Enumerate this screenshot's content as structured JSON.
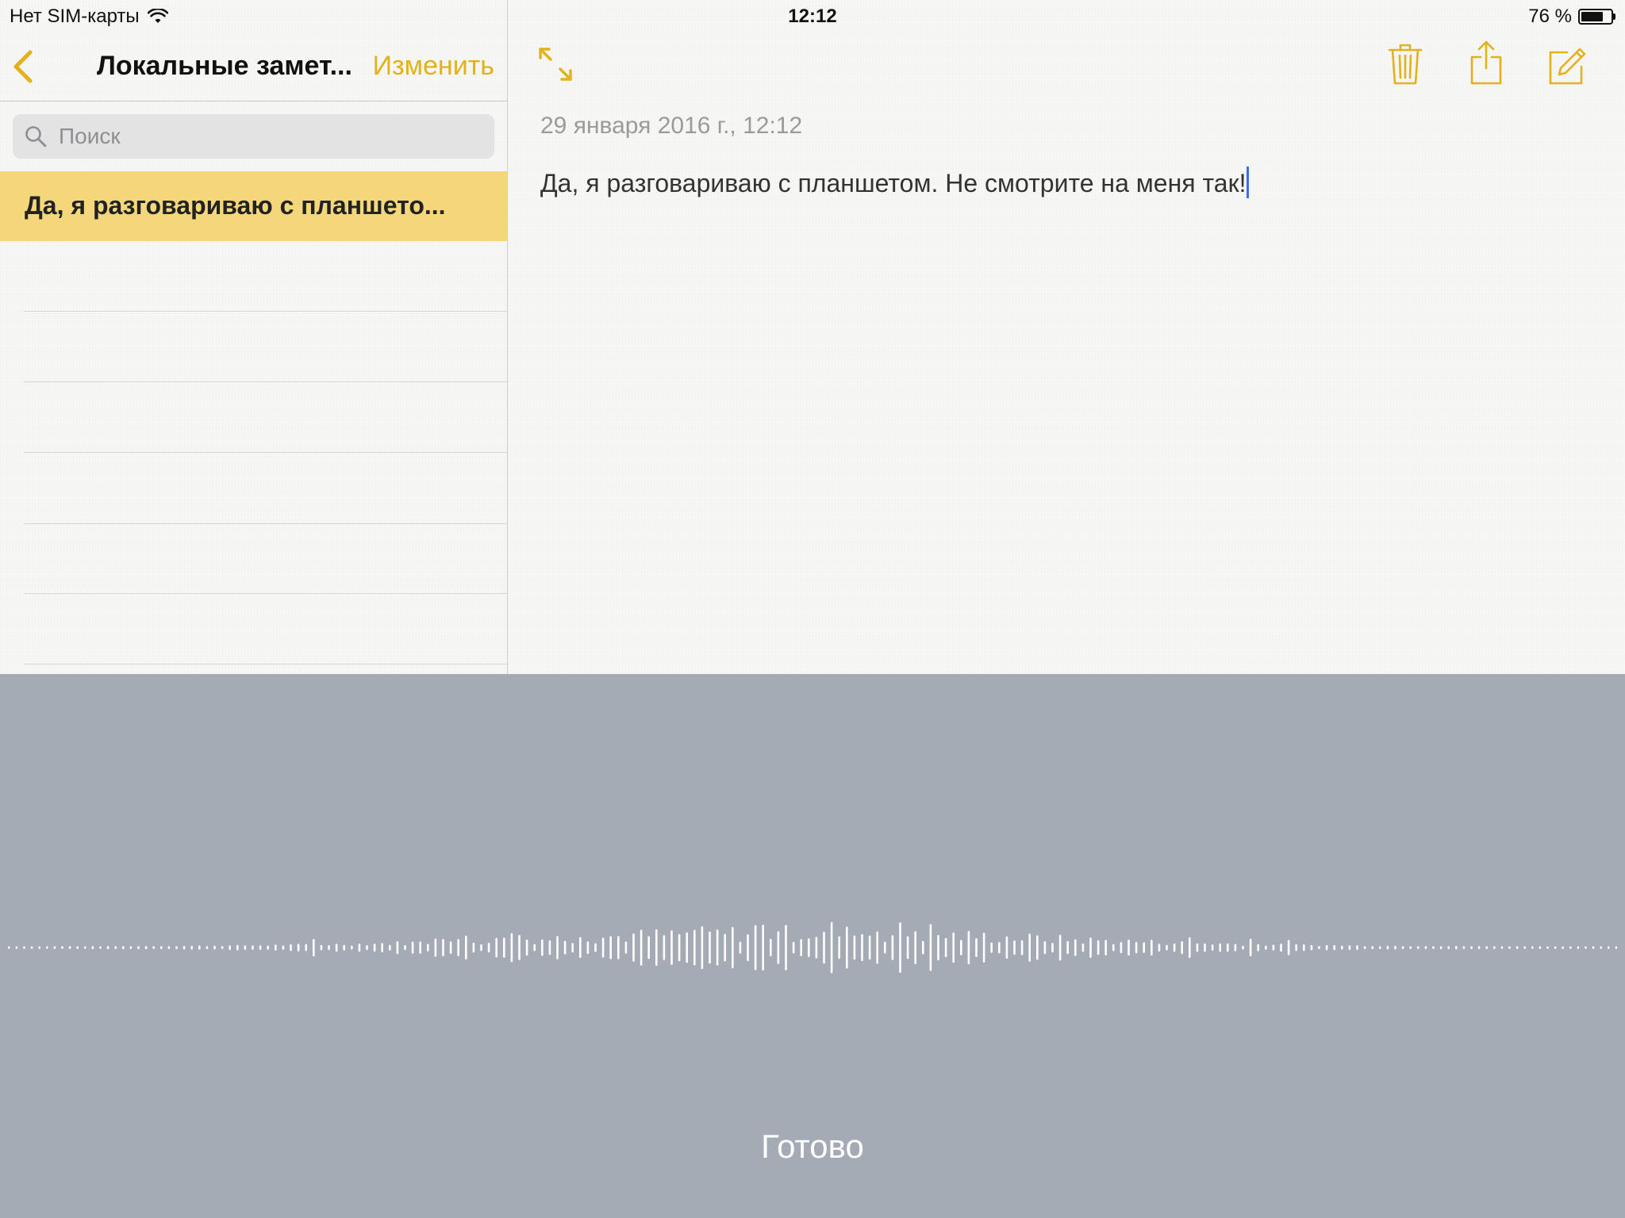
{
  "status_bar": {
    "carrier": "Нет SIM-карты",
    "time": "12:12",
    "battery_text": "76 %",
    "battery_level": 0.76
  },
  "sidebar": {
    "title": "Локальные замет...",
    "edit_label": "Изменить",
    "search_placeholder": "Поиск",
    "notes": [
      {
        "title": "Да, я разговариваю с планшето..."
      }
    ]
  },
  "note": {
    "date": "29 января 2016 г., 12:12",
    "body": "Да, я разговариваю с планшетом. Не смотрите на меня так!"
  },
  "dictation": {
    "done_label": "Готово"
  },
  "colors": {
    "accent": "#e3b118",
    "selected_note_bg": "#f3d77a",
    "dictation_bg": "#a5abb5",
    "cursor": "#3a6cf4"
  },
  "icons": {
    "back": "chevron-left-icon",
    "search": "search-icon",
    "expand": "expand-icon",
    "trash": "trash-icon",
    "share": "share-icon",
    "compose": "compose-icon",
    "wifi": "wifi-icon",
    "battery": "battery-icon"
  }
}
